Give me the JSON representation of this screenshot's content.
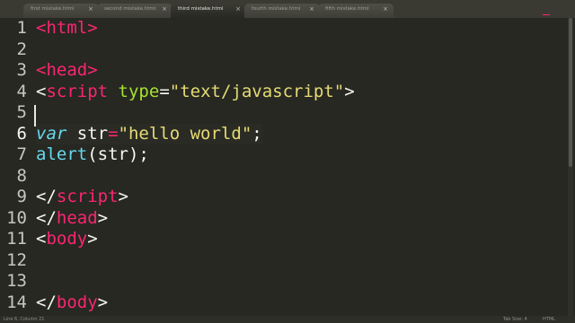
{
  "tabs": [
    {
      "label": "first mistake.html",
      "active": false
    },
    {
      "label": "second mistake.html",
      "active": false
    },
    {
      "label": "third mistake.html",
      "active": true
    },
    {
      "label": "fourth mistake.html",
      "active": false
    },
    {
      "label": "fifth mistake.html",
      "active": false
    }
  ],
  "tab_close_glyph": "×",
  "editor": {
    "current_line": 6,
    "lines": [
      {
        "number": "1",
        "tokens": [
          [
            "tag",
            "<html>"
          ]
        ]
      },
      {
        "number": "2",
        "tokens": []
      },
      {
        "number": "3",
        "tokens": [
          [
            "tag",
            "<head>"
          ]
        ]
      },
      {
        "number": "4",
        "tokens": [
          [
            "plain",
            "<"
          ],
          [
            "tag",
            "script"
          ],
          [
            "plain",
            " "
          ],
          [
            "attr",
            "type"
          ],
          [
            "plain",
            "="
          ],
          [
            "str",
            "\"text/javascript\""
          ],
          [
            "plain",
            ">"
          ]
        ]
      },
      {
        "number": "5",
        "tokens": []
      },
      {
        "number": "6",
        "tokens": [
          [
            "kw",
            "var"
          ],
          [
            "plain",
            " str"
          ],
          [
            "op",
            "="
          ],
          [
            "str",
            "\"hello world\""
          ],
          [
            "plain",
            ";"
          ]
        ]
      },
      {
        "number": "7",
        "tokens": [
          [
            "fn",
            "alert"
          ],
          [
            "plain",
            "(str);"
          ]
        ]
      },
      {
        "number": "8",
        "tokens": []
      },
      {
        "number": "9",
        "tokens": [
          [
            "plain",
            "</"
          ],
          [
            "tag",
            "script"
          ],
          [
            "plain",
            ">"
          ]
        ]
      },
      {
        "number": "10",
        "tokens": [
          [
            "plain",
            "</"
          ],
          [
            "tag",
            "head"
          ],
          [
            "plain",
            ">"
          ]
        ]
      },
      {
        "number": "11",
        "tokens": [
          [
            "plain",
            "<"
          ],
          [
            "tag",
            "body"
          ],
          [
            "plain",
            ">"
          ]
        ]
      },
      {
        "number": "12",
        "tokens": []
      },
      {
        "number": "13",
        "tokens": []
      },
      {
        "number": "14",
        "tokens": [
          [
            "plain",
            "</"
          ],
          [
            "tag",
            "body"
          ],
          [
            "plain",
            ">"
          ]
        ]
      }
    ]
  },
  "status": {
    "position": "Line 6, Column 21",
    "tab_size": "Tab Size: 4",
    "syntax": "HTML"
  },
  "colors": {
    "background": "#272822",
    "tag": "#f92672",
    "attribute": "#a6e22e",
    "string": "#e6db74",
    "keyword": "#66d9ef"
  }
}
